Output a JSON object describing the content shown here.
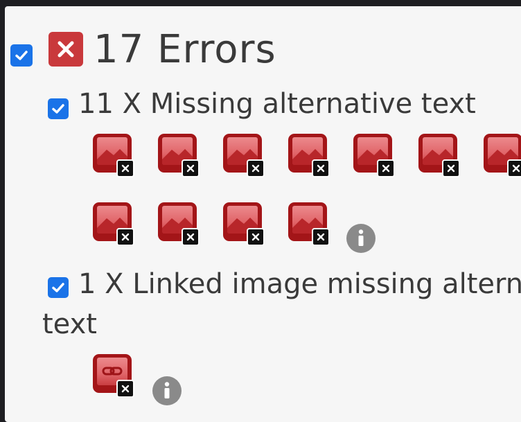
{
  "summary": {
    "title": "17 Errors",
    "checked": true,
    "accent_color": "#1a73e8",
    "error_color": "#c9393c"
  },
  "groups": [
    {
      "label": "11 X Missing alternative text",
      "checked": true,
      "icon": "missing-alt-image-icon",
      "count": 11
    },
    {
      "label_line1": "1 X Linked image missing altern",
      "label_line2": "text",
      "checked": true,
      "icon": "linked-image-icon",
      "count": 1
    }
  ],
  "icons": {
    "info": "info-icon",
    "error": "close-icon",
    "badge": "close-badge-icon"
  }
}
